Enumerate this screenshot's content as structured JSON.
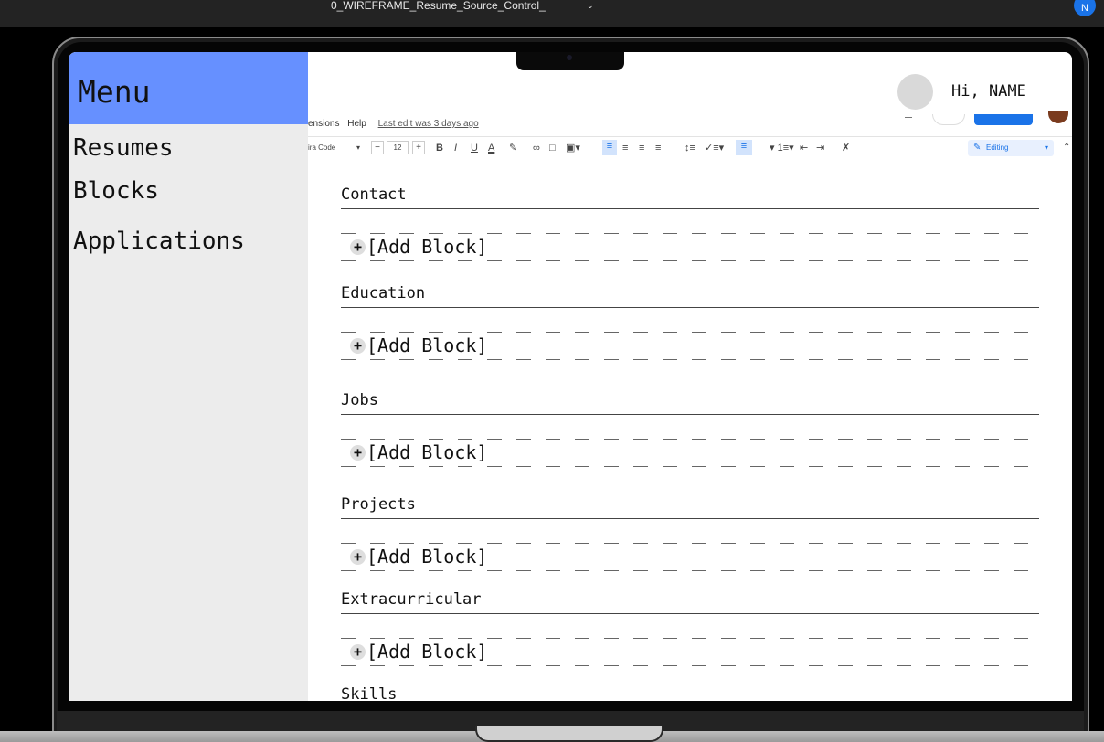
{
  "window": {
    "doc_title": "0_WIREFRAME_Resume_Source_Control_",
    "account_initial": "N"
  },
  "sidebar": {
    "title": "Menu",
    "items": [
      {
        "label": "Resumes"
      },
      {
        "label": "Blocks"
      },
      {
        "label": "Applications"
      }
    ]
  },
  "header": {
    "greeting": "Hi, NAME"
  },
  "docs": {
    "menu_items": [
      "ensions",
      "Help"
    ],
    "last_edit": "Last edit was 3 days ago",
    "font": "ira Code",
    "font_size": "12",
    "mode": "Editing"
  },
  "sections": [
    {
      "title": "Contact",
      "add_label": "[Add Block]"
    },
    {
      "title": "Education",
      "add_label": "[Add Block]"
    },
    {
      "title": "Jobs",
      "add_label": "[Add Block]"
    },
    {
      "title": "Projects",
      "add_label": "[Add Block]"
    },
    {
      "title": "Extracurricular",
      "add_label": "[Add Block]"
    },
    {
      "title": "Skills"
    }
  ],
  "colors": {
    "menu_header": "#6690ff",
    "sidebar_bg": "#ececec",
    "accent_blue": "#1a73e8"
  }
}
